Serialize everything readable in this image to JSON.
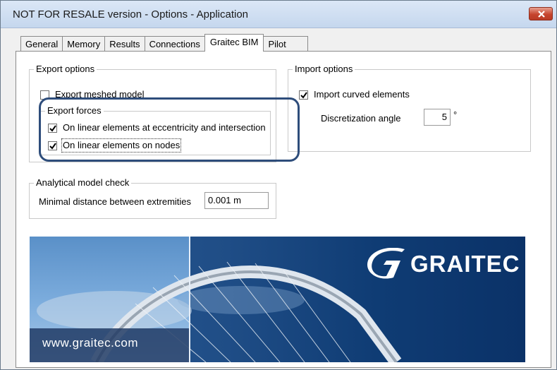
{
  "window": {
    "title": "NOT FOR RESALE version - Options - Application"
  },
  "tabs": [
    {
      "label": "General"
    },
    {
      "label": "Memory"
    },
    {
      "label": "Results"
    },
    {
      "label": "Connections"
    },
    {
      "label": "Graitec BIM",
      "active": true
    },
    {
      "label": "Pilot"
    }
  ],
  "export_options": {
    "legend": "Export options",
    "export_meshed_model": {
      "label": "Export meshed model",
      "checked": false
    },
    "export_forces": {
      "legend": "Export forces",
      "eccentricity": {
        "label": "On linear elements at eccentricity and intersection",
        "checked": true
      },
      "nodes": {
        "label": "On linear elements on nodes",
        "checked": true
      }
    }
  },
  "import_options": {
    "legend": "Import options",
    "import_curved": {
      "label": "Import curved elements",
      "checked": true
    },
    "discretization_label": "Discretization angle",
    "discretization_value": "5",
    "discretization_unit": "°"
  },
  "analytical_check": {
    "legend": "Analytical model check",
    "min_distance_label": "Minimal distance between extremities",
    "min_distance_value": "0.001 m"
  },
  "banner": {
    "logo_text": "GRAITEC",
    "url": "www.graitec.com"
  },
  "colors": {
    "highlight": "#2e4d7b",
    "banner_blue": "#1f4d86",
    "close_red": "#c6452e"
  }
}
